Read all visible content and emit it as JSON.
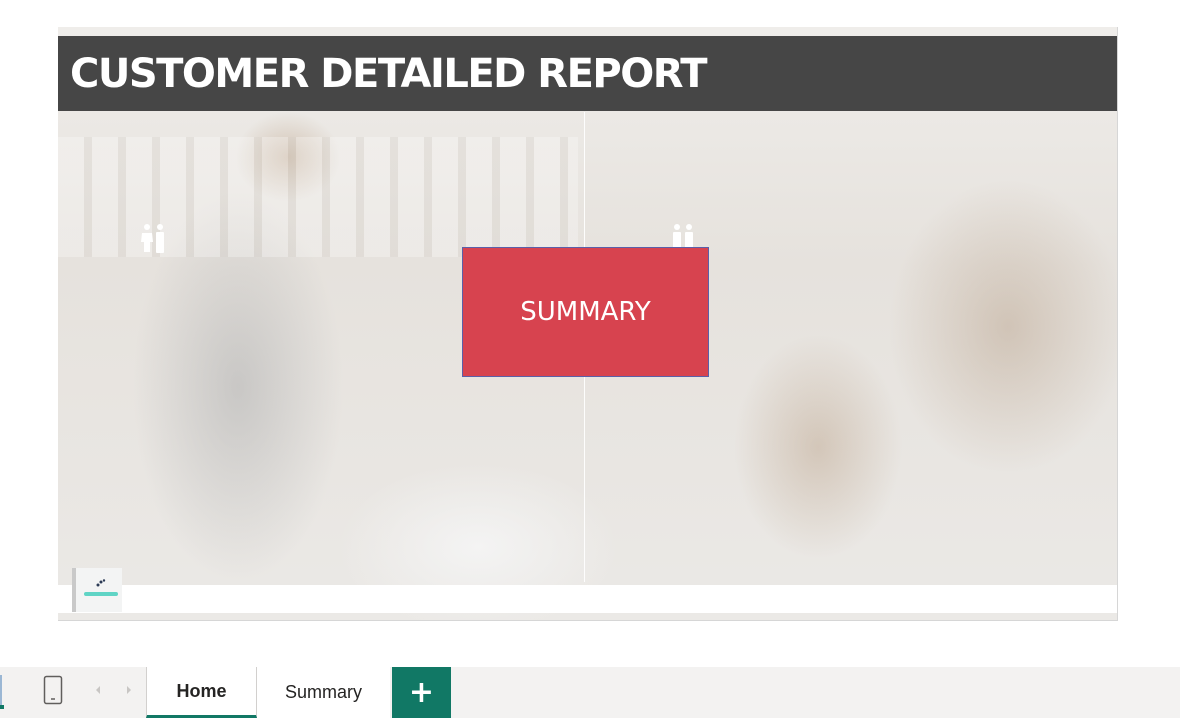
{
  "report": {
    "title": "CUSTOMER DETAILED REPORT",
    "summary_button_label": "SUMMARY",
    "icons": [
      "people-icon",
      "people-icon",
      "company-logo"
    ]
  },
  "tabs": {
    "pages": [
      {
        "label": "Home",
        "active": true
      },
      {
        "label": "Summary",
        "active": false
      }
    ],
    "add_label": "+",
    "icons": [
      "phone-layout-icon",
      "scroll-left-icon",
      "scroll-right-icon"
    ]
  },
  "colors": {
    "title_bar": "#464646",
    "summary_button": "#d7434f",
    "accent": "#117865"
  }
}
